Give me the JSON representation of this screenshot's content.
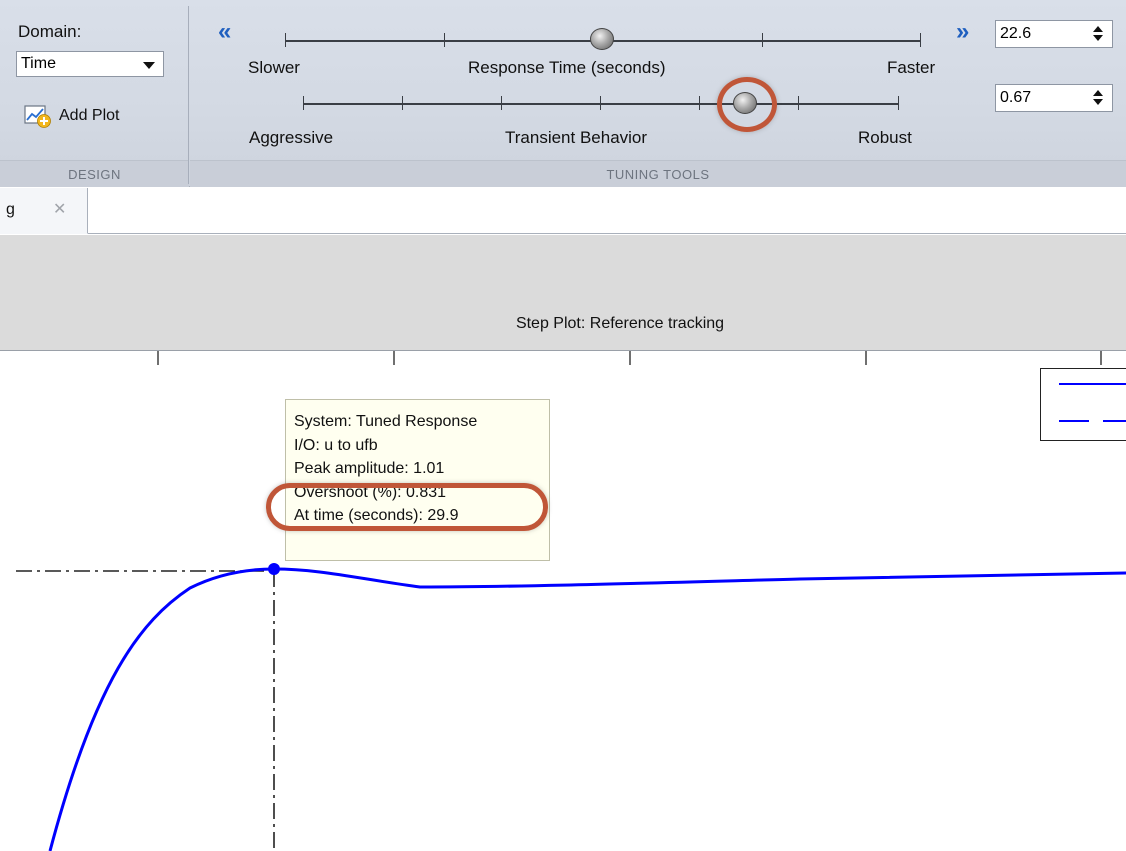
{
  "toolstrip": {
    "design": {
      "domain_label": "Domain:",
      "domain_value": "Time",
      "add_plot_label": "Add Plot",
      "section_label": "DESIGN"
    },
    "tuning": {
      "section_label": "TUNING TOOLS",
      "response_time": {
        "left_label": "Slower",
        "center_label": "Response Time (seconds)",
        "right_label": "Faster",
        "value": "22.6"
      },
      "transient_behavior": {
        "left_label": "Aggressive",
        "center_label": "Transient Behavior",
        "right_label": "Robust",
        "value": "0.67"
      }
    }
  },
  "tab": {
    "label": "g"
  },
  "plot": {
    "title": "Step Plot: Reference tracking",
    "datatip": {
      "line1": "System: Tuned Response",
      "line2": "I/O: u to ufb",
      "line3": "Peak amplitude: 1.01",
      "line4": "Overshoot (%): 0.831",
      "line5": "At time (seconds): 29.9"
    },
    "series_color": "#0000ff",
    "highlight_color": "#c05638"
  }
}
